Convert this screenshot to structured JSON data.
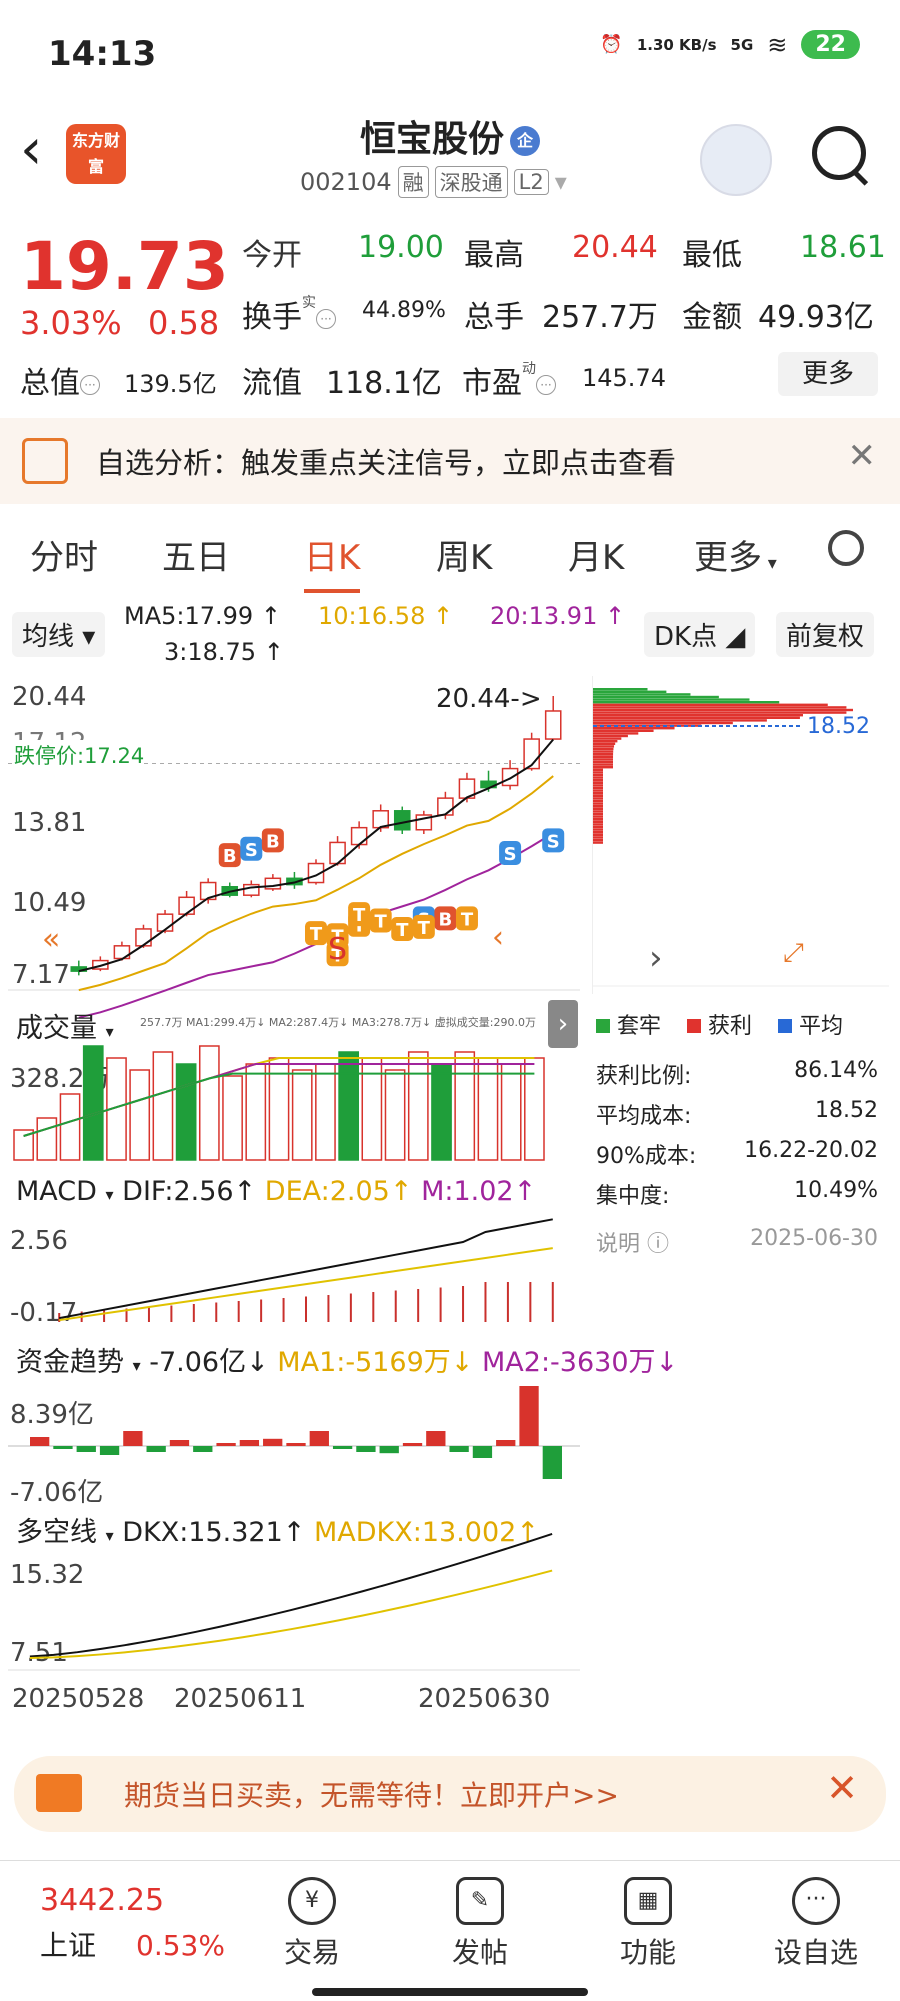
{
  "status": {
    "time": "14:13",
    "net_speed": "1.30 KB/s",
    "net_type": "5G",
    "battery": "22"
  },
  "header": {
    "stock_name": "恒宝股份",
    "badge": "企",
    "code": "002104",
    "tags": [
      "融",
      "深股通",
      "L2"
    ],
    "logo_text": "东方财富"
  },
  "quote": {
    "price": "19.73",
    "change_pct": "3.03%",
    "change": "0.58",
    "open_label": "今开",
    "open": "19.00",
    "high_label": "最高",
    "high": "20.44",
    "low_label": "最低",
    "low": "18.61",
    "turnover_label": "换手",
    "turnover_sup": "实",
    "turnover": "44.89%",
    "volume_label": "总手",
    "volume": "257.7万",
    "amount_label": "金额",
    "amount": "49.93亿",
    "mktcap_label": "总值",
    "mktcap": "139.5亿",
    "float_label": "流值",
    "float": "118.1亿",
    "pe_label": "市盈",
    "pe_sup": "动",
    "pe": "145.74",
    "more": "更多"
  },
  "analysis": {
    "text": "自选分析：触发重点关注信号，立即点击查看"
  },
  "tabs": [
    "分时",
    "五日",
    "日K",
    "周K",
    "月K",
    "更多"
  ],
  "active_tab": "日K",
  "ma": {
    "label": "均线",
    "ma5": "MA5:17.99 ↑",
    "ma10": "10:16.58 ↑",
    "ma20": "20:13.91 ↑",
    "ma3": "3:18.75 ↑",
    "dk": "DK点",
    "fq": "前复权"
  },
  "kchart": {
    "y_top": "20.44",
    "y_mid1": "17.12",
    "y_mid2": "13.81",
    "y_mid3": "10.49",
    "y_bottom": "7.17",
    "high_annot": "20.44->",
    "limit_label": "跌停价:17.24",
    "low_annot": "7.17",
    "letters": [
      "B",
      "S",
      "B",
      "S",
      "B",
      "T",
      "S",
      "T",
      "T",
      "T",
      "T",
      "T",
      "T",
      "T",
      "T",
      "S"
    ],
    "s_mark": "S",
    "candles": [
      {
        "o": 7.6,
        "c": 7.4,
        "h": 7.9,
        "l": 7.2
      },
      {
        "o": 7.5,
        "c": 7.9,
        "h": 8.1,
        "l": 7.4
      },
      {
        "o": 8.0,
        "c": 8.6,
        "h": 8.8,
        "l": 7.9
      },
      {
        "o": 8.6,
        "c": 9.4,
        "h": 9.6,
        "l": 8.5
      },
      {
        "o": 9.3,
        "c": 10.1,
        "h": 10.3,
        "l": 9.2
      },
      {
        "o": 10.1,
        "c": 10.9,
        "h": 11.2,
        "l": 10.0
      },
      {
        "o": 10.8,
        "c": 11.6,
        "h": 11.8,
        "l": 10.6
      },
      {
        "o": 11.4,
        "c": 11.0,
        "h": 11.6,
        "l": 10.9
      },
      {
        "o": 11.0,
        "c": 11.5,
        "h": 11.7,
        "l": 10.9
      },
      {
        "o": 11.3,
        "c": 11.8,
        "h": 12.0,
        "l": 11.2
      },
      {
        "o": 11.8,
        "c": 11.5,
        "h": 12.1,
        "l": 11.3
      },
      {
        "o": 11.6,
        "c": 12.5,
        "h": 12.7,
        "l": 11.5
      },
      {
        "o": 12.5,
        "c": 13.5,
        "h": 13.8,
        "l": 12.4
      },
      {
        "o": 13.4,
        "c": 14.2,
        "h": 14.5,
        "l": 13.2
      },
      {
        "o": 14.2,
        "c": 15.0,
        "h": 15.3,
        "l": 14.0
      },
      {
        "o": 15.0,
        "c": 14.1,
        "h": 15.2,
        "l": 13.9
      },
      {
        "o": 14.1,
        "c": 14.8,
        "h": 15.0,
        "l": 13.9
      },
      {
        "o": 14.8,
        "c": 15.6,
        "h": 15.9,
        "l": 14.6
      },
      {
        "o": 15.6,
        "c": 16.5,
        "h": 16.8,
        "l": 15.4
      },
      {
        "o": 16.4,
        "c": 16.1,
        "h": 16.9,
        "l": 15.9
      },
      {
        "o": 16.2,
        "c": 17.0,
        "h": 17.4,
        "l": 16.0
      },
      {
        "o": 17.0,
        "c": 18.4,
        "h": 18.7,
        "l": 16.9
      },
      {
        "o": 18.4,
        "c": 19.73,
        "h": 20.44,
        "l": 18.61
      }
    ]
  },
  "chip": {
    "avg": "18.52",
    "legend": [
      "套牢",
      "获利",
      "平均"
    ],
    "rows": [
      {
        "k": "获利比例:",
        "v": "86.14%"
      },
      {
        "k": "平均成本:",
        "v": "18.52"
      },
      {
        "k": "90%成本:",
        "v": "16.22-20.02"
      },
      {
        "k": "集中度:",
        "v": "10.49%"
      }
    ],
    "note": "说明",
    "date": "2025-06-30"
  },
  "volume": {
    "label": "成交量",
    "head": "257.7万 MA1:299.4万↓ MA2:287.4万↓ MA3:278.7万↓ 虚拟成交量:290.0万",
    "ymax": "328.2万",
    "bars": [
      0.25,
      0.35,
      0.55,
      0.95,
      0.85,
      0.75,
      0.9,
      0.8,
      0.95,
      0.7,
      0.8,
      0.85,
      0.75,
      0.8,
      0.9,
      0.85,
      0.75,
      0.9,
      0.8,
      0.9,
      0.85,
      0.8,
      0.85
    ],
    "colors": [
      "r",
      "r",
      "r",
      "g",
      "r",
      "r",
      "r",
      "g",
      "r",
      "r",
      "r",
      "r",
      "r",
      "r",
      "g",
      "r",
      "r",
      "r",
      "g",
      "r",
      "r",
      "r",
      "r"
    ]
  },
  "macd": {
    "label": "MACD",
    "dif": "DIF:2.56↑",
    "dea": "DEA:2.05↑",
    "m": "M:1.02↑",
    "ymax": "2.56",
    "ymin": "-0.17"
  },
  "fund": {
    "label": "资金趋势",
    "v": "-7.06亿↓",
    "ma1": "MA1:-5169万↓",
    "ma2": "MA2:-3630万↓",
    "ymax": "8.39亿",
    "ymin": "-7.06亿",
    "bars": [
      0.15,
      -0.05,
      -0.1,
      -0.15,
      0.25,
      -0.1,
      0.1,
      -0.1,
      0.05,
      0.1,
      0.12,
      0.05,
      0.25,
      -0.05,
      -0.1,
      -0.12,
      0.05,
      0.25,
      -0.1,
      -0.2,
      0.1,
      1.0,
      -0.55
    ]
  },
  "dk": {
    "label": "多空线",
    "dkx": "DKX:15.321↑",
    "madkx": "MADKX:13.002↑",
    "ymax": "15.32",
    "ymin": "7.51"
  },
  "dates": [
    "20250528",
    "20250611",
    "20250630"
  ],
  "ad": {
    "text": "期货当日买卖，无需等待！立即开户>>"
  },
  "nav": {
    "index_value": "3442.25",
    "index_name": "上证",
    "index_pct": "0.53%",
    "items": [
      "交易",
      "发帖",
      "功能",
      "设自选"
    ]
  }
}
